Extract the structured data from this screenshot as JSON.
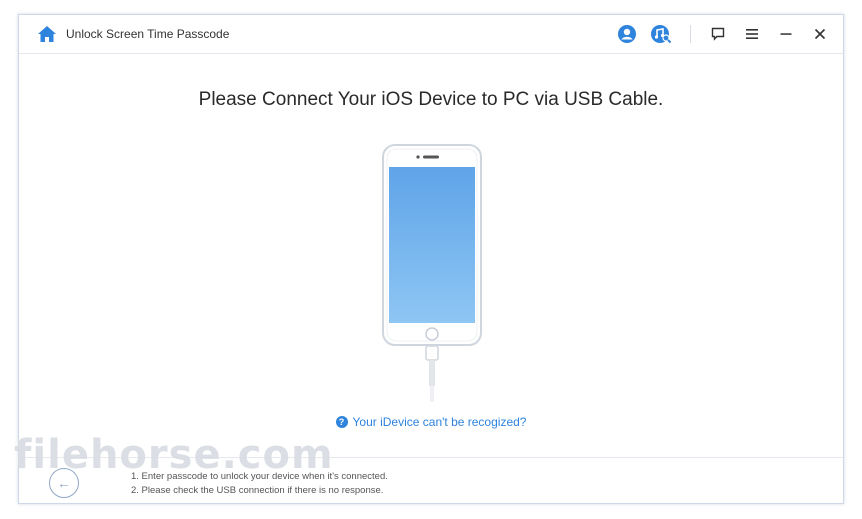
{
  "window": {
    "title": "Unlock Screen Time Passcode"
  },
  "titlebar": {
    "icons": [
      "home-icon",
      "user-icon",
      "music-search-icon",
      "feedback-icon",
      "menu-icon",
      "minimize-icon",
      "close-icon"
    ]
  },
  "main": {
    "heading": "Please Connect Your iOS Device to PC via USB Cable.",
    "help_link": "Your iDevice can't be recogized?"
  },
  "footer": {
    "tips": [
      "1. Enter passcode to unlock your device when it's connected.",
      "2. Please check the USB connection if there is no response."
    ]
  },
  "watermark": "filehorse.com",
  "colors": {
    "accent": "#2e83dd",
    "screen_top": "#5fa4e8",
    "screen_bottom": "#8ec6f4"
  }
}
